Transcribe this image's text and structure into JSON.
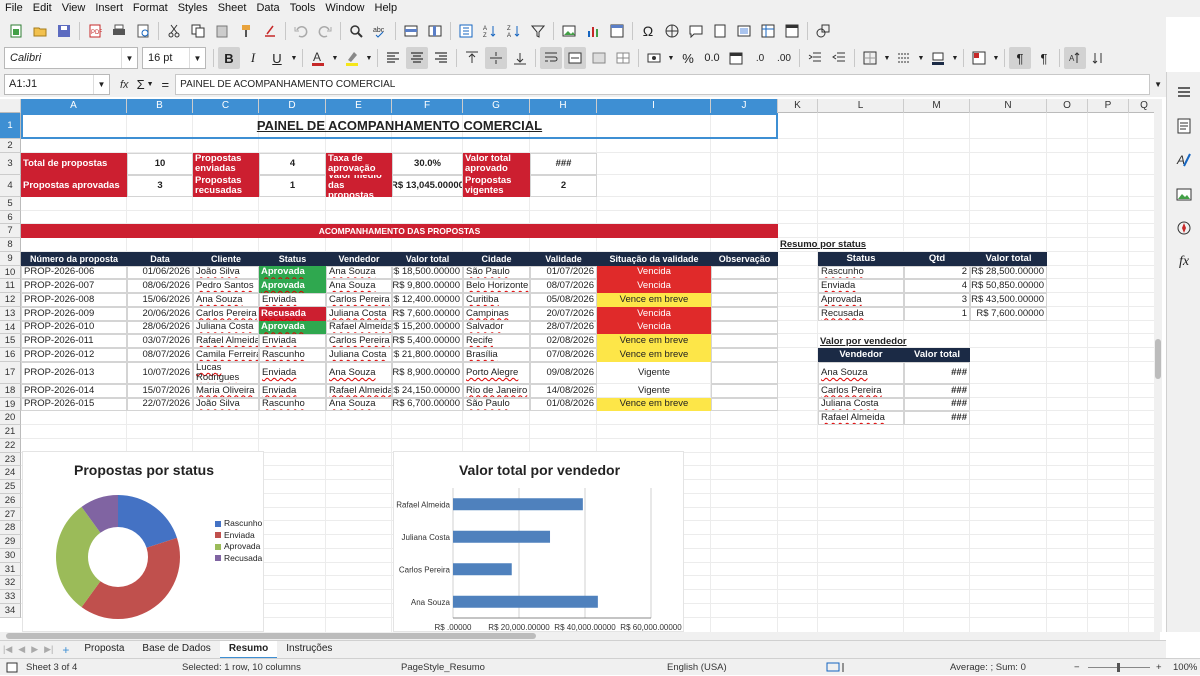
{
  "menu": [
    "File",
    "Edit",
    "View",
    "Insert",
    "Format",
    "Styles",
    "Sheet",
    "Data",
    "Tools",
    "Window",
    "Help"
  ],
  "toolbar": {
    "font_name": "Calibri",
    "font_size": "16 pt"
  },
  "formula_bar": {
    "name_box": "A1:J1",
    "content": "PAINEL DE ACOMPANHAMENTO COMERCIAL",
    "fx": "fx",
    "sum": "Σ",
    "eq": "="
  },
  "columns": [
    "A",
    "B",
    "C",
    "D",
    "E",
    "F",
    "G",
    "H",
    "I",
    "J",
    "K",
    "L",
    "M",
    "N",
    "O",
    "P",
    "Q"
  ],
  "rows": [
    "1",
    "2",
    "3",
    "4",
    "5",
    "6",
    "7",
    "8",
    "9",
    "10",
    "11",
    "12",
    "13",
    "14",
    "15",
    "16",
    "17",
    "18",
    "19",
    "20",
    "21",
    "22",
    "23",
    "24",
    "25",
    "26",
    "27",
    "28",
    "29",
    "30",
    "31",
    "32",
    "33",
    "34"
  ],
  "title": "PAINEL DE ACOMPANHAMENTO COMERCIAL",
  "kpis": {
    "total_label": "Total de propostas",
    "total_value": "10",
    "approved_label": "Propostas aprovadas",
    "approved_value": "3",
    "sent_label": "Propostas enviadas",
    "sent_value": "4",
    "refused_label": "Propostas recusadas",
    "refused_value": "1",
    "rate_label": "Taxa de aprovação",
    "rate_value": "30.0%",
    "avg_label": "Valor médio das propostas",
    "avg_value": "R$ 13,045.00000",
    "approved_total_label": "Valor total aprovado",
    "approved_total_value": "###",
    "active_label": "Propostas vigentes",
    "active_value": "2"
  },
  "section_title": "ACOMPANHAMENTO DAS PROPOSTAS",
  "table": {
    "headers": [
      "Número da proposta",
      "Data",
      "Cliente",
      "Status",
      "Vendedor",
      "Valor total",
      "Cidade",
      "Validade",
      "Situação da validade",
      "Observação"
    ],
    "rows": [
      [
        "PROP-2026-006",
        "01/06/2026",
        "João Silva",
        "Aprovada",
        "Ana Souza",
        "R$ 18,500.00000",
        "São Paulo",
        "01/07/2026",
        "Vencida",
        ""
      ],
      [
        "PROP-2026-007",
        "08/06/2026",
        "Pedro Santos",
        "Aprovada",
        "Ana Souza",
        "R$ 9,800.00000",
        "Belo Horizonte",
        "08/07/2026",
        "Vencida",
        ""
      ],
      [
        "PROP-2026-008",
        "15/06/2026",
        "Ana Souza",
        "Enviada",
        "Carlos Pereira",
        "R$ 12,400.00000",
        "Curitiba",
        "05/08/2026",
        "Vence em breve",
        ""
      ],
      [
        "PROP-2026-009",
        "20/06/2026",
        "Carlos Pereira",
        "Recusada",
        "Juliana Costa",
        "R$ 7,600.00000",
        "Campinas",
        "20/07/2026",
        "Vencida",
        ""
      ],
      [
        "PROP-2026-010",
        "28/06/2026",
        "Juliana Costa",
        "Aprovada",
        "Rafael Almeida",
        "R$ 15,200.00000",
        "Salvador",
        "28/07/2026",
        "Vencida",
        ""
      ],
      [
        "PROP-2026-011",
        "03/07/2026",
        "Rafael Almeida",
        "Enviada",
        "Carlos Pereira",
        "R$ 5,400.00000",
        "Recife",
        "02/08/2026",
        "Vence em breve",
        ""
      ],
      [
        "PROP-2026-012",
        "08/07/2026",
        "Camila Ferreira",
        "Rascunho",
        "Juliana Costa",
        "R$ 21,800.00000",
        "Brasília",
        "07/08/2026",
        "Vence em breve",
        ""
      ],
      [
        "PROP-2026-013",
        "10/07/2026",
        "Lucas Rodrigues",
        "Enviada",
        "Ana Souza",
        "R$ 8,900.00000",
        "Porto Alegre",
        "09/08/2026",
        "Vigente",
        ""
      ],
      [
        "PROP-2026-014",
        "15/07/2026",
        "Maria Oliveira",
        "Enviada",
        "Rafael Almeida",
        "R$ 24,150.00000",
        "Rio de Janeiro",
        "14/08/2026",
        "Vigente",
        ""
      ],
      [
        "PROP-2026-015",
        "22/07/2026",
        "João Silva",
        "Rascunho",
        "Ana Souza",
        "R$ 6,700.00000",
        "São Paulo",
        "01/08/2026",
        "Vence em breve",
        ""
      ]
    ]
  },
  "status_summary": {
    "title": "Resumo por status",
    "headers": [
      "Status",
      "Qtd",
      "Valor total"
    ],
    "rows": [
      [
        "Rascunho",
        "2",
        "R$ 28,500.00000"
      ],
      [
        "Enviada",
        "4",
        "R$ 50,850.00000"
      ],
      [
        "Aprovada",
        "3",
        "R$ 43,500.00000"
      ],
      [
        "Recusada",
        "1",
        "R$ 7,600.00000"
      ]
    ]
  },
  "seller_summary": {
    "title": "Valor por vendedor",
    "headers": [
      "Vendedor",
      "Valor total"
    ],
    "rows": [
      [
        "Ana Souza",
        "###"
      ],
      [
        "Carlos Pereira",
        "###"
      ],
      [
        "Juliana Costa",
        "###"
      ],
      [
        "Rafael Almeida",
        "###"
      ]
    ]
  },
  "chart_data": [
    {
      "type": "pie",
      "title": "Propostas por status",
      "categories": [
        "Rascunho",
        "Enviada",
        "Aprovada",
        "Recusada"
      ],
      "values": [
        2,
        4,
        3,
        1
      ],
      "colors": [
        "#4472c4",
        "#c0504d",
        "#9bbb59",
        "#8064a2"
      ],
      "legend": "right",
      "donut": true
    },
    {
      "type": "bar",
      "orientation": "horizontal",
      "title": "Valor total por vendedor",
      "categories": [
        "Rafael Almeida",
        "Juliana Costa",
        "Carlos Pereira",
        "Ana Souza"
      ],
      "values": [
        39350,
        29400,
        17800,
        43900
      ],
      "xlim": [
        0,
        60000
      ],
      "xticks": [
        "R$ .00000",
        "R$ 20,000.00000",
        "R$ 40,000.00000",
        "R$ 60,000.00000"
      ],
      "color": "#4f81bd",
      "grid": true
    }
  ],
  "sheet_tabs": [
    "Proposta",
    "Base de Dados",
    "Resumo",
    "Instruções"
  ],
  "active_tab": "Resumo",
  "statusbar": {
    "sheet": "Sheet 3 of 4",
    "selection": "Selected: 1 row, 10 columns",
    "pagestyle": "PageStyle_Resumo",
    "language": "English (USA)",
    "formula": "Average: ; Sum: 0",
    "zoom": "100%"
  }
}
